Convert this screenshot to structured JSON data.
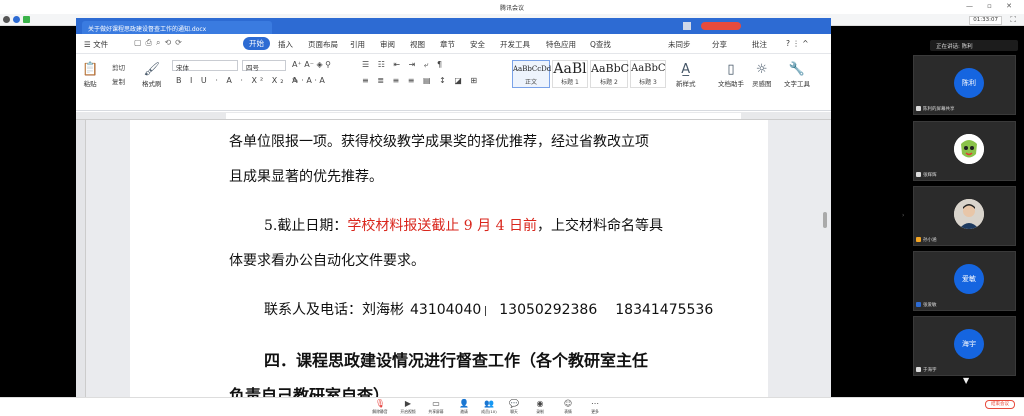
{
  "app": {
    "title": "腾讯会议",
    "window_controls": "— ▫ ✕",
    "clock": "01:33:07"
  },
  "wps": {
    "tab_title": "关于做好课程思政建设督查工作的通知.docx",
    "menu": {
      "file": "☰ 文件",
      "start": "开始",
      "items": [
        "插入",
        "页面布局",
        "引用",
        "审阅",
        "视图",
        "章节",
        "安全",
        "开发工具",
        "特色应用"
      ],
      "search": "Q查找",
      "right": [
        "未同步",
        "分享",
        "批注"
      ],
      "help": "? ⋮ ^"
    },
    "ribbon": {
      "paste": "粘贴",
      "cut": "剪切",
      "copy": "复制",
      "format_painter": "格式刷",
      "font": "宋体",
      "size": "四号",
      "styles": [
        {
          "preview": "AaBbCcDd",
          "label": "正文"
        },
        {
          "preview": "AaBl",
          "label": "标题 1"
        },
        {
          "preview": "AaBbC",
          "label": "标题 2"
        },
        {
          "preview": "AaBbC",
          "label": "标题 3"
        }
      ],
      "new_style": "新样式",
      "doc_helper": "文档助手",
      "inspiration": "灵感图",
      "text_tools": "文字工具"
    }
  },
  "document": {
    "line1": "各单位限报一项。获得校级教学成果奖的择优推荐，经过省教改立项",
    "line2": "且成果显著的优先推荐。",
    "line3": {
      "prefix": "5.截止日期：",
      "red": "学校材料报送截止 9 月 4 日前",
      "suffix": "，上交材料命名等具"
    },
    "line4": "体要求看办公自动化文件要求。",
    "contact": {
      "label": "联系人及电话：刘海彬",
      "phone1": "43104040",
      "phone2": "13050292386",
      "phone3": "18341475536"
    },
    "heading": "四．课程思政建设情况进行督查工作（各个教研室主任",
    "heading2": "负责自己教研室自查）"
  },
  "controls": [
    "解除静音",
    "开启视频",
    "共享屏幕",
    "邀请",
    "成员(10)",
    "聊天",
    "录制",
    "表情",
    "更多"
  ],
  "end_label": "结束会议",
  "panel": {
    "header": "正在讲话: 陈利",
    "participants": [
      {
        "avatar": "陈利",
        "name": "陈利的屏幕共享"
      },
      {
        "avatar": "",
        "name": "张辉辉"
      },
      {
        "avatar": "",
        "name": "孙小涵"
      },
      {
        "avatar": "爱敏",
        "name": "张爱敏"
      },
      {
        "avatar": "海宇",
        "name": "于海宇"
      }
    ]
  },
  "colors": {
    "accent": "#2d6bd3",
    "highlight_red": "#d9261c",
    "avatar_blue": "#1565e0"
  }
}
